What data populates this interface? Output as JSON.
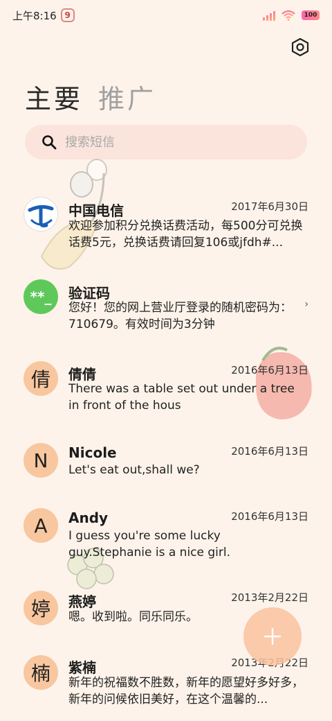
{
  "status_bar": {
    "time": "上午8:16",
    "notification_icon": "9",
    "battery": "100"
  },
  "header": {
    "settings_icon": "hexagon-gear-icon",
    "tabs": [
      {
        "label": "主要",
        "active": true
      },
      {
        "label": "推广",
        "active": false
      }
    ]
  },
  "search": {
    "placeholder": "搜索短信"
  },
  "messages": [
    {
      "name": "中国电信",
      "avatar_text": "",
      "date": "2017年6月30日",
      "preview": "欢迎参加积分兑换话费活动，每500分可兑换话费5元，兑换话费请回复106或jfdh#..."
    },
    {
      "name": "验证码",
      "avatar_text": "**_",
      "date": "",
      "preview": "您好！您的网上营业厅登录的随机密码为：710679。有效时间为3分钟"
    },
    {
      "name": "倩倩",
      "avatar_text": "倩",
      "date": "2016年6月13日",
      "preview": "There was a table set out under a tree in front of the hous"
    },
    {
      "name": "Nicole",
      "avatar_text": "N",
      "date": "2016年6月13日",
      "preview": "Let's eat out,shall we?"
    },
    {
      "name": "Andy",
      "avatar_text": "A",
      "date": "2016年6月13日",
      "preview": "I guess you're some lucky guy.Stephanie is a nice girl."
    },
    {
      "name": "燕婷",
      "avatar_text": "婷",
      "date": "2013年2月22日",
      "preview": "嗯。收到啦。同乐同乐。"
    },
    {
      "name": "紫楠",
      "avatar_text": "楠",
      "date": "2013年2月22日",
      "preview": "新年的祝福数不胜数，新年的愿望好多好多，新年的问候依旧美好，在这个温馨的..."
    }
  ],
  "colors": {
    "background": "#fdf3ea",
    "search_bg": "#fbe4dc",
    "avatar_bg": "#f8c79f",
    "verify_avatar": "#5ec95a",
    "fab": "#fac2a0",
    "telecom_blue": "#1a5fb4"
  }
}
